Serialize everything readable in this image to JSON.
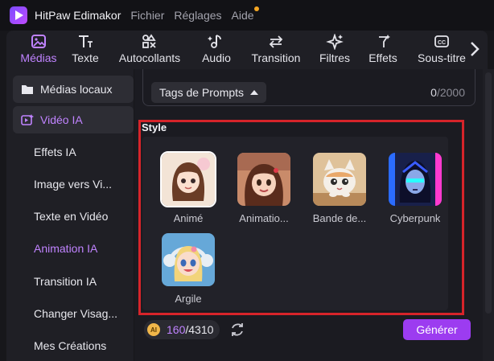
{
  "app": {
    "title": "HitPaw Edimakor"
  },
  "menu": [
    "Fichier",
    "Réglages",
    "Aide"
  ],
  "tabs": [
    {
      "label": "Médias",
      "icon": "media-icon",
      "active": true
    },
    {
      "label": "Texte",
      "icon": "text-icon"
    },
    {
      "label": "Autocollants",
      "icon": "stickers-icon"
    },
    {
      "label": "Audio",
      "icon": "audio-icon"
    },
    {
      "label": "Transition",
      "icon": "transition-icon"
    },
    {
      "label": "Filtres",
      "icon": "filters-icon"
    },
    {
      "label": "Effets",
      "icon": "effects-icon"
    },
    {
      "label": "Sous-titre",
      "icon": "subtitles-icon"
    }
  ],
  "sidebar": {
    "items": [
      {
        "label": "Médias locaux",
        "type": "group"
      },
      {
        "label": "Vidéo IA",
        "type": "group",
        "accent": true
      },
      {
        "label": "Effets IA",
        "type": "sub"
      },
      {
        "label": "Image vers Vi...",
        "type": "sub"
      },
      {
        "label": "Texte en Vidéo",
        "type": "sub"
      },
      {
        "label": "Animation IA",
        "type": "sub",
        "accent": true
      },
      {
        "label": "Transition IA",
        "type": "sub"
      },
      {
        "label": "Changer Visag...",
        "type": "sub"
      },
      {
        "label": "Mes Créations",
        "type": "sub"
      }
    ]
  },
  "prompt": {
    "tags_button": "Tags de Prompts",
    "counter_current": "0",
    "counter_max": "/2000"
  },
  "style": {
    "title": "Style",
    "options": [
      {
        "label": "Animé",
        "selected": true
      },
      {
        "label": "Animatio..."
      },
      {
        "label": "Bande de..."
      },
      {
        "label": "Cyberpunk"
      },
      {
        "label": "Argile"
      }
    ]
  },
  "footer": {
    "ai_badge": "AI",
    "credits_used": "160",
    "credits_total": "/4310",
    "generate": "Générer"
  },
  "colors": {
    "accent": "#c083ff",
    "generate_button": "#9c3cf0",
    "highlight_frame": "#d6242a",
    "background": "#17171b"
  }
}
